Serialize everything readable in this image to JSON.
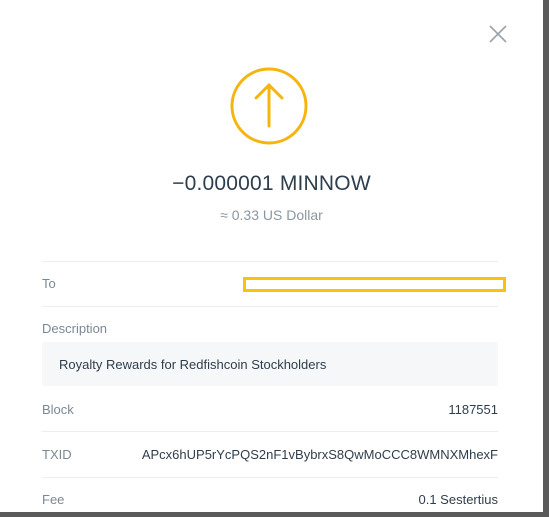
{
  "transaction": {
    "amount": "−0.000001 MINNOW",
    "fiat_value": "≈ 0.33 US Dollar",
    "direction_icon": "arrow-up-icon",
    "accent_color": "#f6b40e"
  },
  "fields": {
    "to_label": "To",
    "description_label": "Description",
    "description_value": "Royalty Rewards for Redfishcoin Stockholders",
    "block_label": "Block",
    "block_value": "1187551",
    "txid_label": "TXID",
    "txid_value": "APcx6hUP5rYcPQS2nF1vBybrxS8QwMoCCC8WMNXMhexF",
    "fee_label": "Fee",
    "fee_value": "0.1 Sestertius"
  },
  "icons": {
    "close": "close-icon"
  }
}
